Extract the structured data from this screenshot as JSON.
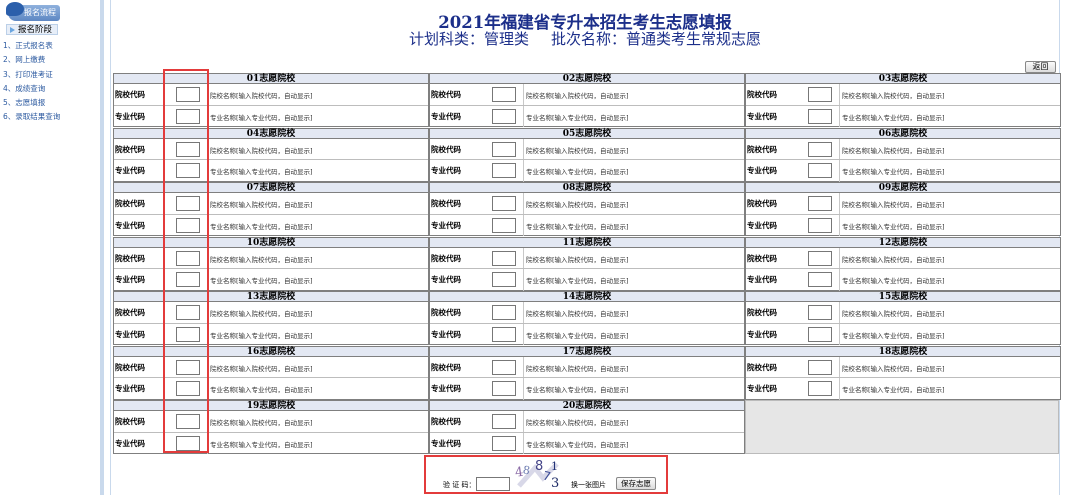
{
  "sidebar": {
    "header": "报名流程",
    "section": "报名阶段",
    "items": [
      {
        "label": "1、正式报名表"
      },
      {
        "label": "2、网上缴费"
      },
      {
        "label": "3、打印准考证"
      },
      {
        "label": "4、成绩查询"
      },
      {
        "label": "5、志愿填报"
      },
      {
        "label": "6、录取结果查询"
      }
    ]
  },
  "header": {
    "title": "2021年福建省专升本招生考生志愿填报",
    "subject_label": "计划科类：管理类",
    "batch_label": "批次名称：普通类考生常规志愿"
  },
  "toolbar": {
    "back_label": "返回"
  },
  "form": {
    "school_code_label": "院校代码",
    "major_code_label": "专业代码",
    "school_hint": "院校名称[输入院校代码，自动显示]",
    "major_hint": "专业名称[输入专业代码，自动显示]",
    "choices": [
      {
        "title": "01志愿院校"
      },
      {
        "title": "02志愿院校"
      },
      {
        "title": "03志愿院校"
      },
      {
        "title": "04志愿院校"
      },
      {
        "title": "05志愿院校"
      },
      {
        "title": "06志愿院校"
      },
      {
        "title": "07志愿院校"
      },
      {
        "title": "08志愿院校"
      },
      {
        "title": "09志愿院校"
      },
      {
        "title": "10志愿院校"
      },
      {
        "title": "11志愿院校"
      },
      {
        "title": "12志愿院校"
      },
      {
        "title": "13志愿院校"
      },
      {
        "title": "14志愿院校"
      },
      {
        "title": "15志愿院校"
      },
      {
        "title": "16志愿院校"
      },
      {
        "title": "17志愿院校"
      },
      {
        "title": "18志愿院校"
      },
      {
        "title": "19志愿院校"
      },
      {
        "title": "20志愿院校"
      }
    ]
  },
  "captcha": {
    "label": "验 证 码：",
    "image_text": "48 7 1 3",
    "refresh_label": "换一张图片",
    "save_label": "保存志愿"
  },
  "colors": {
    "title": "#1c2f8a",
    "sidebar_link": "#2c5aa0",
    "block_header": "#e3e8f3",
    "highlight": "#e33b3b"
  }
}
